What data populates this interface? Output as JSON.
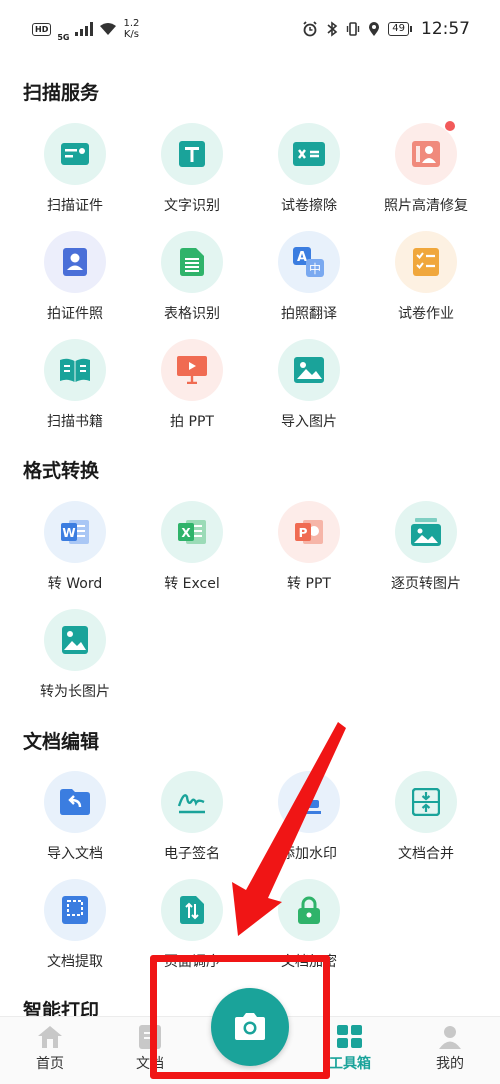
{
  "status_bar": {
    "hd": "HD",
    "network": "5G",
    "speed_value": "1.2",
    "speed_unit": "K/s",
    "battery": "49",
    "time": "12:57"
  },
  "sections": [
    {
      "title": "扫描服务",
      "tools": [
        {
          "label": "扫描证件",
          "icon": "id-card-icon"
        },
        {
          "label": "文字识别",
          "icon": "text-t-icon"
        },
        {
          "label": "试卷擦除",
          "icon": "exam-erase-icon"
        },
        {
          "label": "照片高清修复",
          "icon": "photo-restore-icon"
        },
        {
          "label": "拍证件照",
          "icon": "id-photo-icon"
        },
        {
          "label": "表格识别",
          "icon": "table-icon"
        },
        {
          "label": "拍照翻译",
          "icon": "translate-icon"
        },
        {
          "label": "试卷作业",
          "icon": "homework-icon"
        },
        {
          "label": "扫描书籍",
          "icon": "book-icon"
        },
        {
          "label": "拍 PPT",
          "icon": "ppt-screen-icon"
        },
        {
          "label": "导入图片",
          "icon": "image-icon"
        }
      ]
    },
    {
      "title": "格式转换",
      "tools": [
        {
          "label": "转 Word",
          "icon": "word-icon"
        },
        {
          "label": "转 Excel",
          "icon": "excel-icon"
        },
        {
          "label": "转 PPT",
          "icon": "ppt-icon"
        },
        {
          "label": "逐页转图片",
          "icon": "pages-to-image-icon"
        },
        {
          "label": "转为长图片",
          "icon": "long-image-icon"
        }
      ]
    },
    {
      "title": "文档编辑",
      "tools": [
        {
          "label": "导入文档",
          "icon": "import-doc-icon"
        },
        {
          "label": "电子签名",
          "icon": "signature-icon"
        },
        {
          "label": "添加水印",
          "icon": "watermark-icon"
        },
        {
          "label": "文档合并",
          "icon": "merge-icon"
        },
        {
          "label": "文档提取",
          "icon": "extract-icon"
        },
        {
          "label": "页面调序",
          "icon": "reorder-icon"
        },
        {
          "label": "文档加密",
          "icon": "lock-icon"
        }
      ]
    },
    {
      "title": "智能打印",
      "tools": []
    }
  ],
  "nav": {
    "home": "首页",
    "docs": "文档",
    "toolbox": "工具箱",
    "mine": "我的"
  },
  "colors": {
    "accent": "#1aa39a",
    "annotation": "#f01515"
  }
}
